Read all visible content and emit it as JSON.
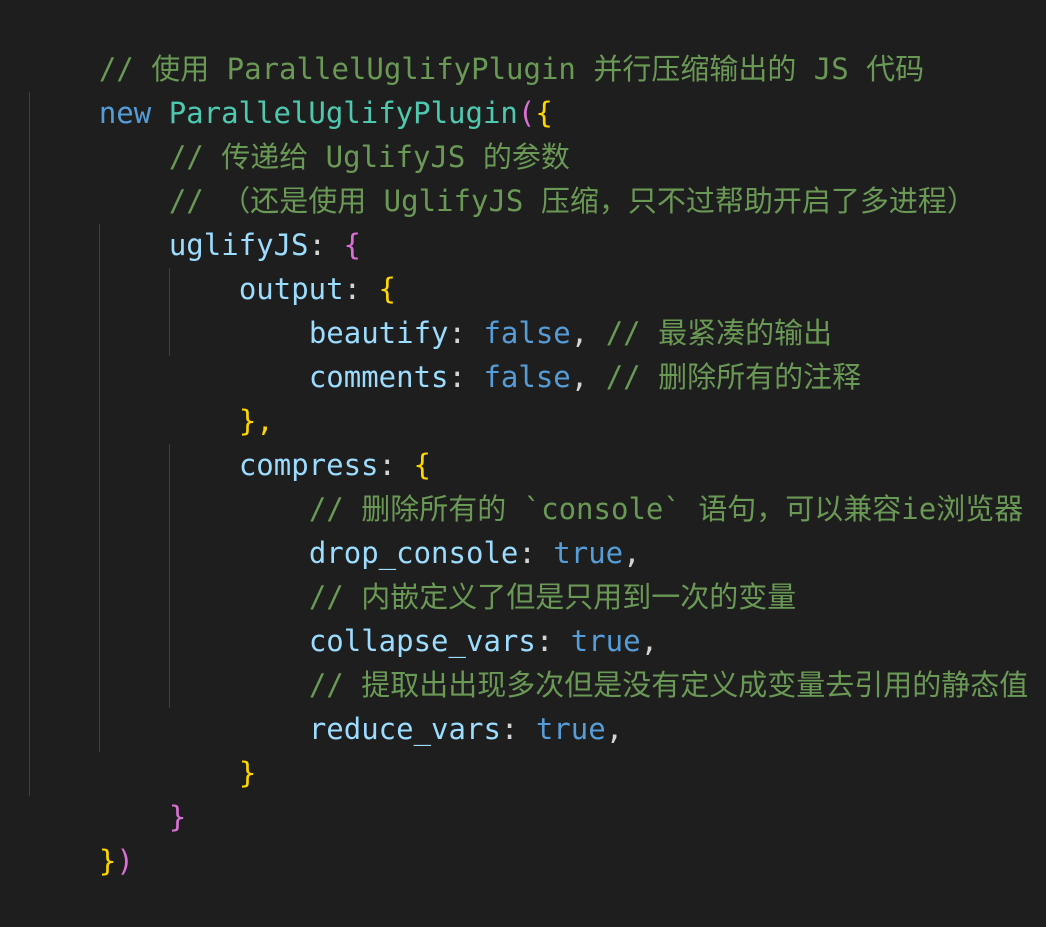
{
  "editor": {
    "lines": [
      {
        "text": "// 使用 ParallelUglifyPlugin 并行压缩输出的 JS 代码"
      },
      {
        "keyword": "new",
        "class_name": "ParallelUglifyPlugin",
        "open": "({"
      },
      {
        "text": "// 传递给 UglifyJS 的参数"
      },
      {
        "text": "// （还是使用 UglifyJS 压缩，只不过帮助开启了多进程）"
      },
      {
        "prop": "uglifyJS",
        "colon": ":",
        "open": "{"
      },
      {
        "prop": "output",
        "colon": ":",
        "open": "{"
      },
      {
        "prop": "beautify",
        "colon": ":",
        "value": "false",
        "comma": ",",
        "comment": "// 最紧凑的输出"
      },
      {
        "prop": "comments",
        "colon": ":",
        "value": "false",
        "comma": ",",
        "comment": "// 删除所有的注释"
      },
      {
        "close": "},"
      },
      {
        "prop": "compress",
        "colon": ":",
        "open": "{"
      },
      {
        "text": "// 删除所有的 `console` 语句，可以兼容ie浏览器"
      },
      {
        "prop": "drop_console",
        "colon": ":",
        "value": "true",
        "comma": ","
      },
      {
        "text": "// 内嵌定义了但是只用到一次的变量"
      },
      {
        "prop": "collapse_vars",
        "colon": ":",
        "value": "true",
        "comma": ","
      },
      {
        "text": "// 提取出出现多次但是没有定义成变量去引用的静态值"
      },
      {
        "prop": "reduce_vars",
        "colon": ":",
        "value": "true",
        "comma": ","
      },
      {
        "close": "}"
      },
      {
        "close": "}"
      },
      {
        "close": "})"
      }
    ]
  },
  "theme": {
    "background": "#1e1e1e",
    "comment": "#6a9955",
    "keyword": "#569cd6",
    "class": "#4ec9b0",
    "property": "#9cdcfe",
    "punctuation": "#d4d4d4",
    "bracket": "#ffd700",
    "paren": "#da70d6"
  }
}
